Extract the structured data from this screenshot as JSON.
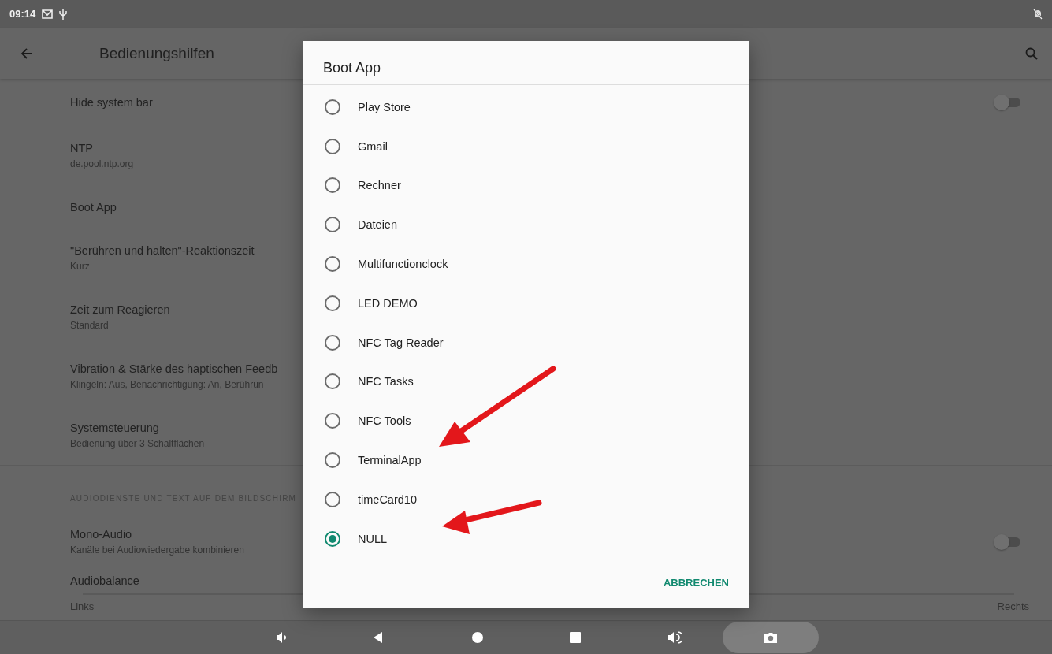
{
  "status_bar": {
    "time": "09:14"
  },
  "app_bar": {
    "title": "Bedienungshilfen"
  },
  "settings": [
    {
      "kind": "toggle",
      "title": "Hide system bar",
      "on": false
    },
    {
      "kind": "item",
      "title": "NTP",
      "subtitle": "de.pool.ntp.org"
    },
    {
      "kind": "item",
      "title": "Boot App"
    },
    {
      "kind": "item",
      "title": "\"Berühren und halten\"-Reaktionszeit",
      "subtitle": "Kurz"
    },
    {
      "kind": "item",
      "title": "Zeit zum Reagieren",
      "subtitle": "Standard"
    },
    {
      "kind": "item",
      "title": "Vibration & Stärke des haptischen Feedb",
      "subtitle": "Klingeln: Aus, Benachrichtigung: An, Berührun"
    },
    {
      "kind": "item",
      "title": "Systemsteuerung",
      "subtitle": "Bedienung über 3 Schaltflächen"
    },
    {
      "kind": "header",
      "title": "AUDIODIENSTE UND TEXT AUF DEM BILDSCHIRM"
    },
    {
      "kind": "toggle",
      "title": "Mono-Audio",
      "subtitle": "Kanäle bei Audiowiedergabe kombinieren",
      "on": false
    },
    {
      "kind": "balance",
      "title": "Audiobalance",
      "left_label": "Links",
      "right_label": "Rechts"
    }
  ],
  "dialog": {
    "title": "Boot App",
    "options": [
      {
        "label": "Play Store",
        "selected": false
      },
      {
        "label": "Gmail",
        "selected": false
      },
      {
        "label": "Rechner",
        "selected": false
      },
      {
        "label": "Dateien",
        "selected": false
      },
      {
        "label": "Multifunctionclock",
        "selected": false
      },
      {
        "label": "LED DEMO",
        "selected": false
      },
      {
        "label": "NFC Tag Reader",
        "selected": false
      },
      {
        "label": "NFC Tasks",
        "selected": false
      },
      {
        "label": "NFC Tools",
        "selected": false
      },
      {
        "label": "TerminalApp",
        "selected": false
      },
      {
        "label": "timeCard10",
        "selected": false
      },
      {
        "label": "NULL",
        "selected": true
      }
    ],
    "button": "ABBRECHEN"
  }
}
